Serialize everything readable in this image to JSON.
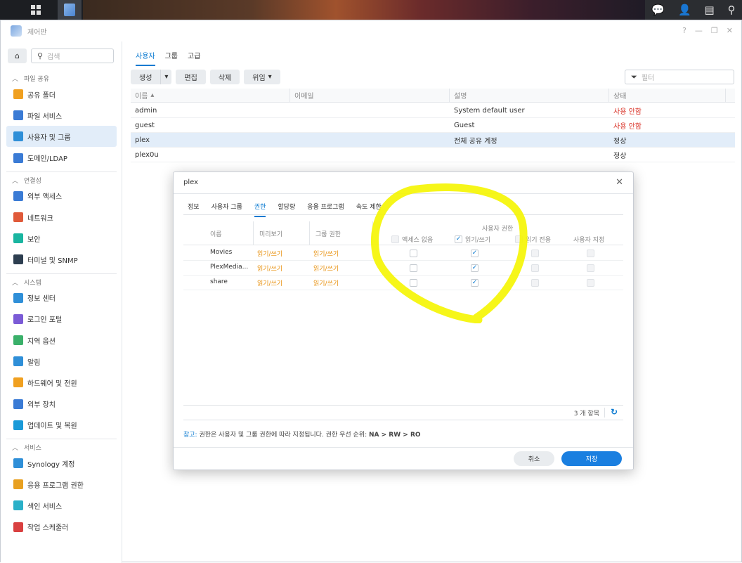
{
  "window": {
    "title": "제어판"
  },
  "sidebar": {
    "search_placeholder": "검색",
    "sections": [
      {
        "label": "파일 공유",
        "items": [
          {
            "label": "공유 폴더",
            "icon": "folder-icon"
          },
          {
            "label": "파일 서비스",
            "icon": "file-service-icon"
          },
          {
            "label": "사용자 및 그룹",
            "icon": "users-icon",
            "active": true
          },
          {
            "label": "도메인/LDAP",
            "icon": "domain-icon"
          }
        ]
      },
      {
        "label": "연결성",
        "items": [
          {
            "label": "외부 액세스",
            "icon": "external-access-icon"
          },
          {
            "label": "네트워크",
            "icon": "network-icon"
          },
          {
            "label": "보안",
            "icon": "security-icon"
          },
          {
            "label": "터미널 및 SNMP",
            "icon": "terminal-icon"
          }
        ]
      },
      {
        "label": "시스템",
        "items": [
          {
            "label": "정보 센터",
            "icon": "info-icon"
          },
          {
            "label": "로그인 포털",
            "icon": "login-portal-icon"
          },
          {
            "label": "지역 옵션",
            "icon": "region-icon"
          },
          {
            "label": "알림",
            "icon": "notification-icon"
          },
          {
            "label": "하드웨어 및 전원",
            "icon": "hardware-icon"
          },
          {
            "label": "외부 장치",
            "icon": "external-device-icon"
          },
          {
            "label": "업데이트 및 복원",
            "icon": "update-icon"
          }
        ]
      },
      {
        "label": "서비스",
        "items": [
          {
            "label": "Synology 계정",
            "icon": "synology-account-icon"
          },
          {
            "label": "응용 프로그램 권한",
            "icon": "app-privilege-icon"
          },
          {
            "label": "색인 서비스",
            "icon": "index-icon"
          },
          {
            "label": "작업 스케줄러",
            "icon": "scheduler-icon"
          }
        ]
      }
    ]
  },
  "main": {
    "tabs": [
      "사용자",
      "그룹",
      "고급"
    ],
    "toolbar": {
      "create": "생성",
      "edit": "편집",
      "delete": "삭제",
      "delegate": "위임"
    },
    "filter_placeholder": "필터",
    "columns": [
      "이름",
      "이메일",
      "설명",
      "상태"
    ],
    "rows": [
      {
        "name": "admin",
        "email": "",
        "desc": "System default user",
        "status": "사용 안함",
        "status_color": "#d93025"
      },
      {
        "name": "guest",
        "email": "",
        "desc": "Guest",
        "status": "사용 안함",
        "status_color": "#d93025"
      },
      {
        "name": "plex",
        "email": "",
        "desc": "전체 공유 계정",
        "status": "정상",
        "selected": true
      },
      {
        "name": "plex0u",
        "email": "",
        "desc": "",
        "status": "정상"
      }
    ]
  },
  "dialog": {
    "title": "plex",
    "tabs": [
      "정보",
      "사용자 그룹",
      "권한",
      "할당량",
      "응용 프로그램",
      "속도 제한"
    ],
    "perm_columns": {
      "name": "이름",
      "preview": "미리보기",
      "group": "그룹 권한",
      "user_perm": "사용자 권한",
      "na": "액세스 없음",
      "rw": "읽기/쓰기",
      "ro": "읽기 전용",
      "custom": "사용자 지정"
    },
    "perm_rows": [
      {
        "name": "Movies",
        "preview": "읽기/쓰기",
        "group": "읽기/쓰기",
        "na": false,
        "rw": true,
        "ro": false,
        "custom": false
      },
      {
        "name": "PlexMedia...",
        "preview": "읽기/쓰기",
        "group": "읽기/쓰기",
        "na": false,
        "rw": true,
        "ro": false,
        "custom": false
      },
      {
        "name": "share",
        "preview": "읽기/쓰기",
        "group": "읽기/쓰기",
        "na": false,
        "rw": true,
        "ro": false,
        "custom": false
      }
    ],
    "count": "3 개 항목",
    "note_label": "참고:",
    "note_text": " 권한은 사용자 및 그룹 권한에 따라 지정됩니다. 권한 우선 순위: ",
    "note_priority": "NA > RW > RO",
    "cancel": "취소",
    "save": "저장"
  },
  "colors": {
    "accent": "#0a7ad1",
    "highlight": "#f5f500",
    "warning": "#e8900c",
    "error": "#d93025"
  }
}
